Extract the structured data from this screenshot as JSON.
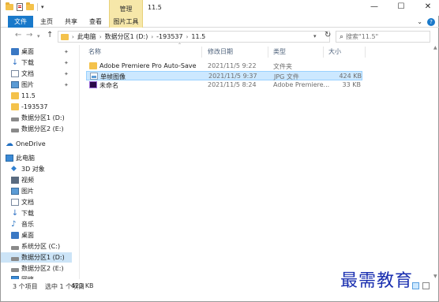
{
  "window": {
    "title": "11.5",
    "context_tab_group": "管理",
    "controls": [
      "—",
      "☐",
      "✕"
    ]
  },
  "ribbon": {
    "tabs": [
      "文件",
      "主页",
      "共享",
      "查看",
      "图片工具"
    ],
    "expand_glyph": "⌄",
    "help_glyph": "?"
  },
  "address": {
    "breadcrumbs": [
      "此电脑",
      "数据分区1 (D:)",
      "-193537",
      "11.5"
    ],
    "search_placeholder": "搜索\"11.5\""
  },
  "sidebar": {
    "items": [
      {
        "label": "桌面",
        "icon": "desktop-icon",
        "pinned": true
      },
      {
        "label": "下载",
        "icon": "download-icon",
        "pinned": true
      },
      {
        "label": "文档",
        "icon": "document-icon",
        "pinned": true
      },
      {
        "label": "图片",
        "icon": "picture-icon",
        "pinned": true
      },
      {
        "label": "11.5",
        "icon": "folder-icon",
        "pinned": false
      },
      {
        "label": "-193537",
        "icon": "folder-icon",
        "pinned": false
      },
      {
        "label": "数据分区1 (D:)",
        "icon": "drive-icon",
        "pinned": false
      },
      {
        "label": "数据分区2 (E:)",
        "icon": "drive-icon",
        "pinned": false
      },
      {
        "label": "OneDrive",
        "icon": "cloud-icon",
        "pinned": false
      },
      {
        "label": "此电脑",
        "icon": "pc-icon",
        "pinned": false
      },
      {
        "label": "3D 对象",
        "icon": "3d-objects-icon",
        "pinned": false
      },
      {
        "label": "视频",
        "icon": "video-icon",
        "pinned": false
      },
      {
        "label": "图片",
        "icon": "picture-icon",
        "pinned": false
      },
      {
        "label": "文档",
        "icon": "document-icon",
        "pinned": false
      },
      {
        "label": "下载",
        "icon": "download-icon",
        "pinned": false
      },
      {
        "label": "音乐",
        "icon": "music-icon",
        "pinned": false
      },
      {
        "label": "桌面",
        "icon": "desktop-icon",
        "pinned": false
      },
      {
        "label": "系统分区 (C:)",
        "icon": "drive-icon",
        "pinned": false
      },
      {
        "label": "数据分区1 (D:)",
        "icon": "drive-icon",
        "pinned": false,
        "selected": true
      },
      {
        "label": "数据分区2 (E:)",
        "icon": "drive-icon",
        "pinned": false
      },
      {
        "label": "网络",
        "icon": "network-icon",
        "pinned": false
      }
    ]
  },
  "columns": {
    "name": "名称",
    "date": "修改日期",
    "type": "类型",
    "size": "大小"
  },
  "files": [
    {
      "name": "Adobe Premiere Pro Auto-Save",
      "date": "2021/11/5 9:22",
      "type": "文件夹",
      "size": "",
      "icon": "folder-icon"
    },
    {
      "name": "单帧图像",
      "date": "2021/11/5 9:37",
      "type": "JPG 文件",
      "size": "424 KB",
      "icon": "jpg-file-icon",
      "selected": true
    },
    {
      "name": "未命名",
      "date": "2021/11/5 8:24",
      "type": "Adobe Premiere...",
      "size": "33 KB",
      "icon": "premiere-project-icon"
    }
  ],
  "status": {
    "count": "3 个项目",
    "selected": "选中 1 个项目",
    "size": "423 KB"
  },
  "watermark": "最需教育",
  "colors": {
    "accent": "#1979ca",
    "context_tab": "#f6e7a9",
    "selection": "#cce8ff",
    "watermark": "#1a2fb0"
  }
}
